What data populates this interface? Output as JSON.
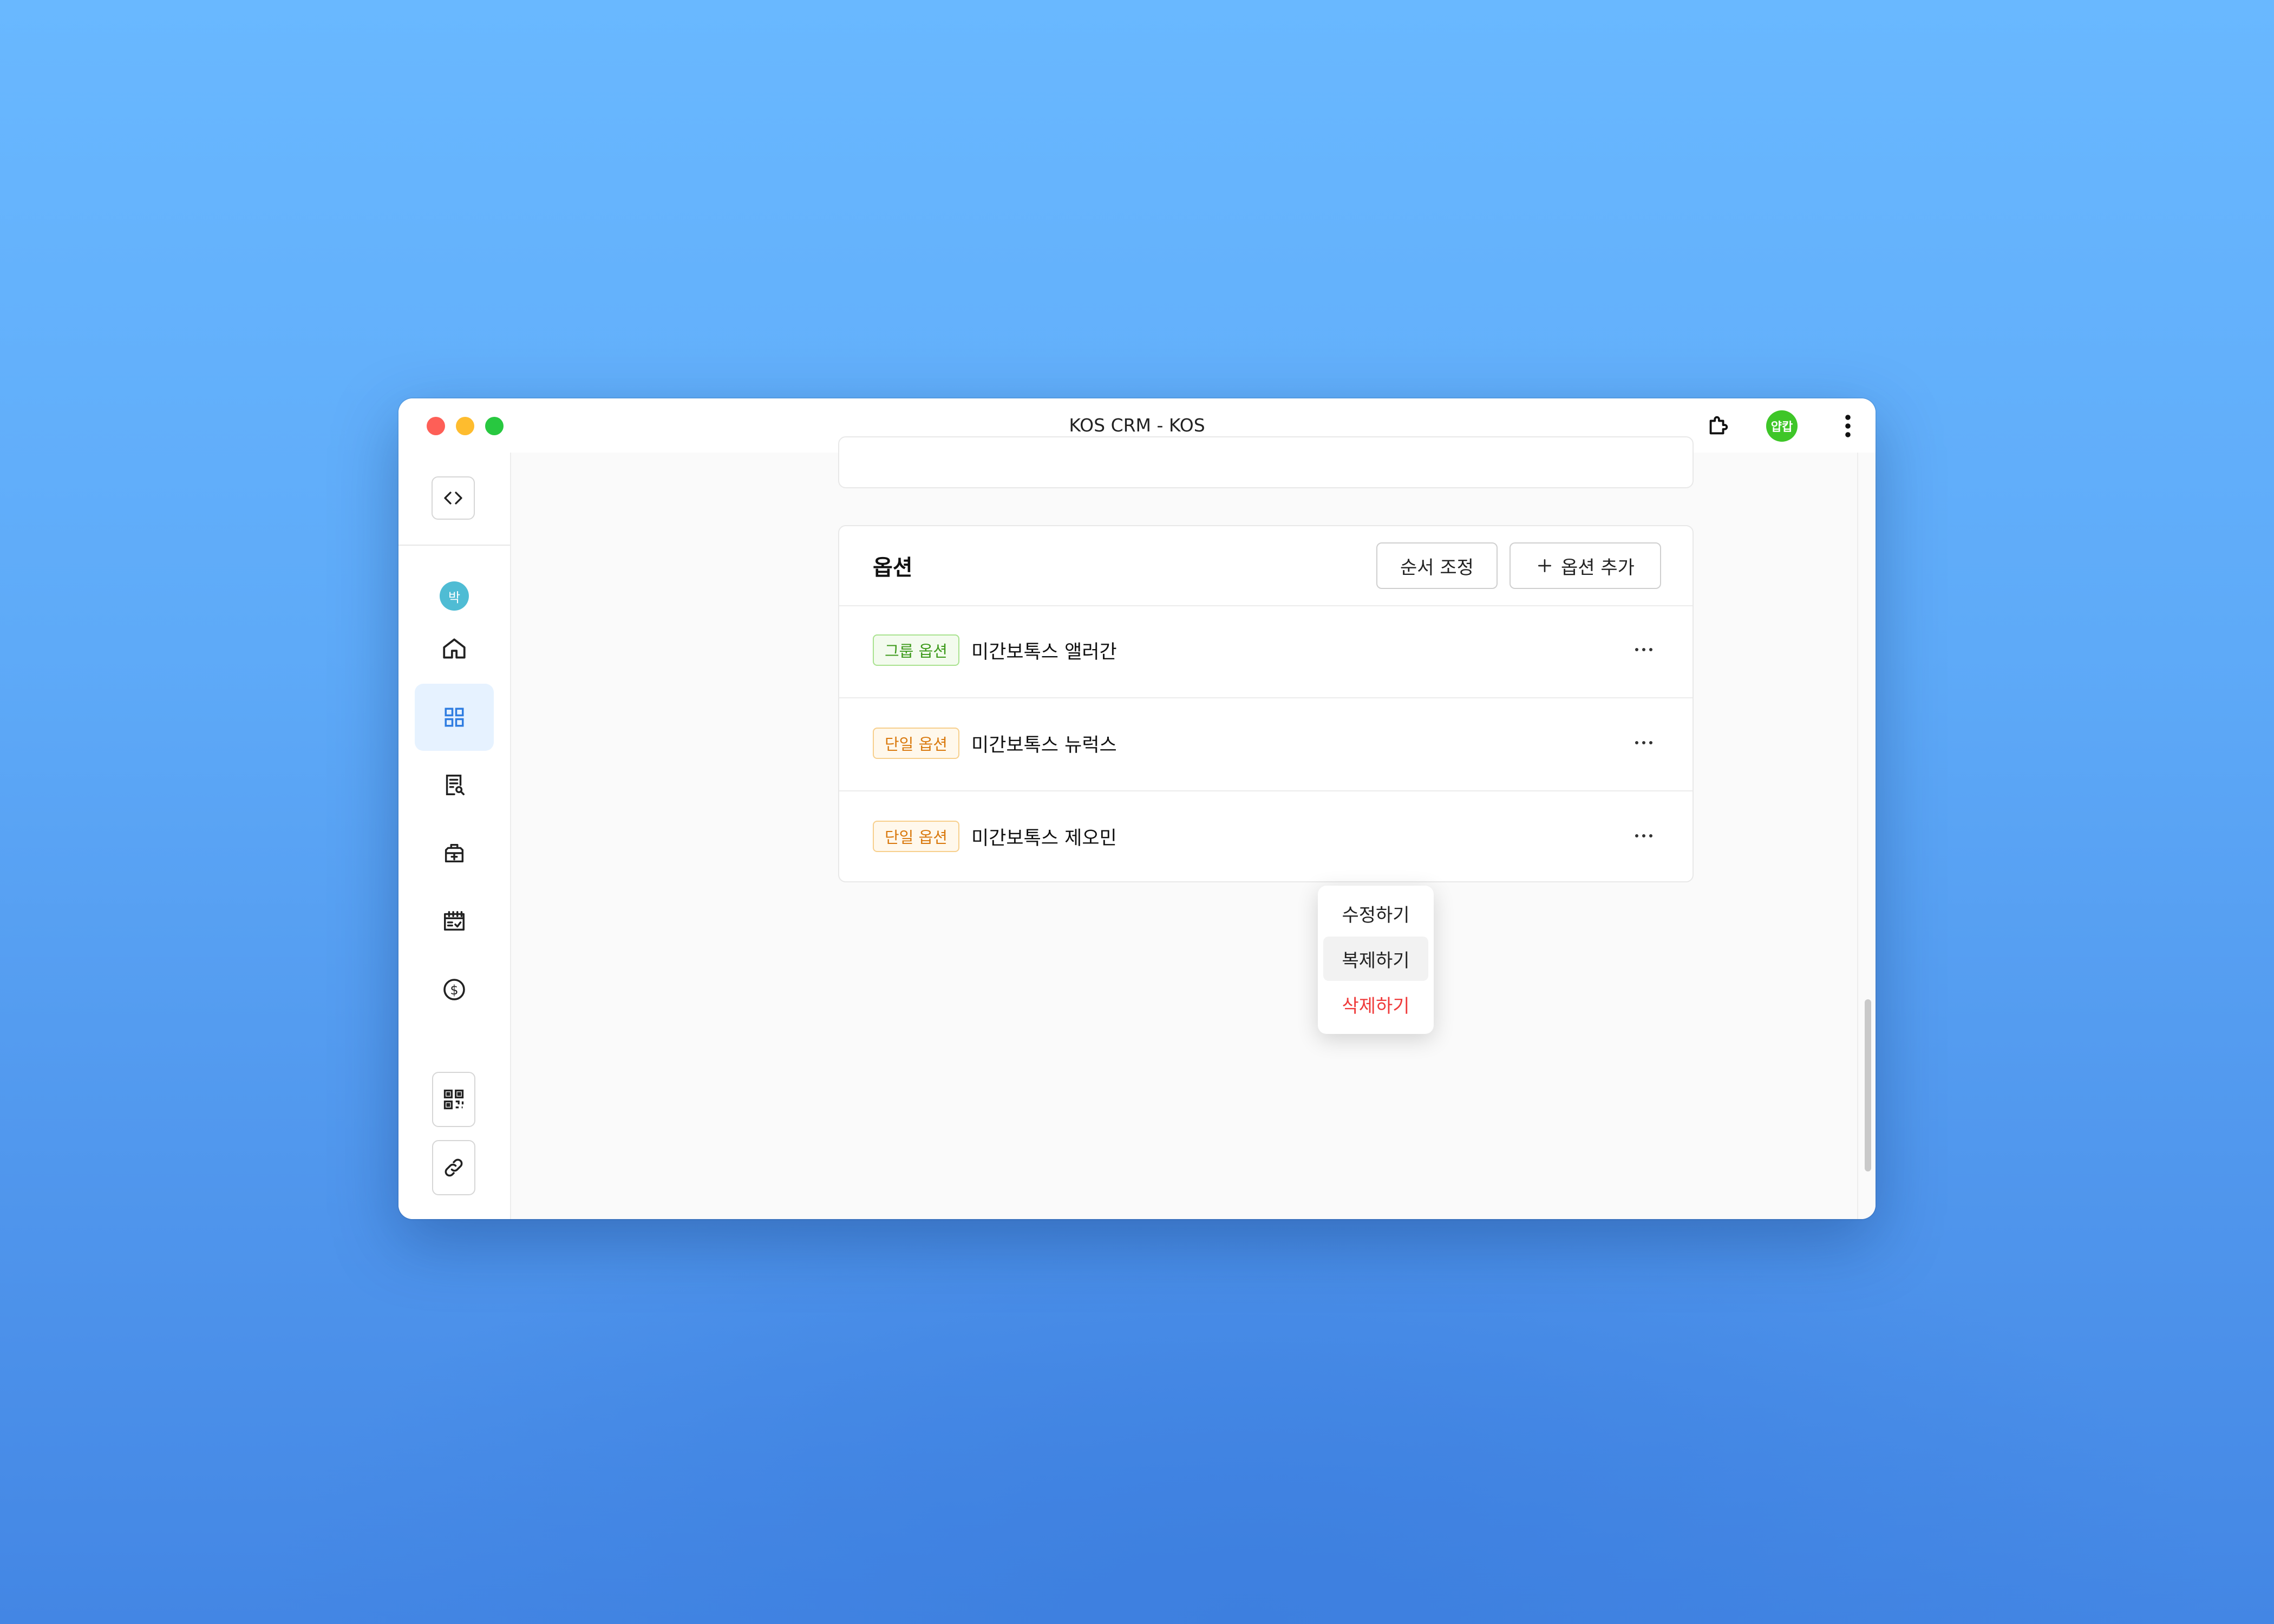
{
  "window": {
    "title": "KOS CRM - KOS"
  },
  "toolbar": {
    "profile_label": "얍캅"
  },
  "sidebar": {
    "user_initial": "박",
    "items": [
      {
        "icon": "home-icon"
      },
      {
        "icon": "grid-icon",
        "active": true
      },
      {
        "icon": "receipt-search-icon"
      },
      {
        "icon": "medical-bag-icon"
      },
      {
        "icon": "calendar-check-icon"
      },
      {
        "icon": "dollar-circle-icon"
      },
      {
        "icon": "qr-code-icon"
      },
      {
        "icon": "link-icon"
      }
    ]
  },
  "options_card": {
    "title": "옵션",
    "reorder_label": "순서 조정",
    "add_label": "옵션 추가",
    "rows": [
      {
        "tag": "그룹 옵션",
        "tag_type": "group",
        "name": "미간보톡스 앨러간"
      },
      {
        "tag": "단일 옵션",
        "tag_type": "single",
        "name": "미간보톡스 뉴럭스"
      },
      {
        "tag": "단일 옵션",
        "tag_type": "single",
        "name": "미간보톡스 제오민"
      }
    ]
  },
  "context_menu": {
    "edit": "수정하기",
    "duplicate": "복제하기",
    "delete": "삭제하기"
  },
  "colors": {
    "accent": "#2f7de1",
    "group_tag": "#3d9a1b",
    "single_tag": "#d9790e",
    "danger": "#ef3b3b"
  }
}
